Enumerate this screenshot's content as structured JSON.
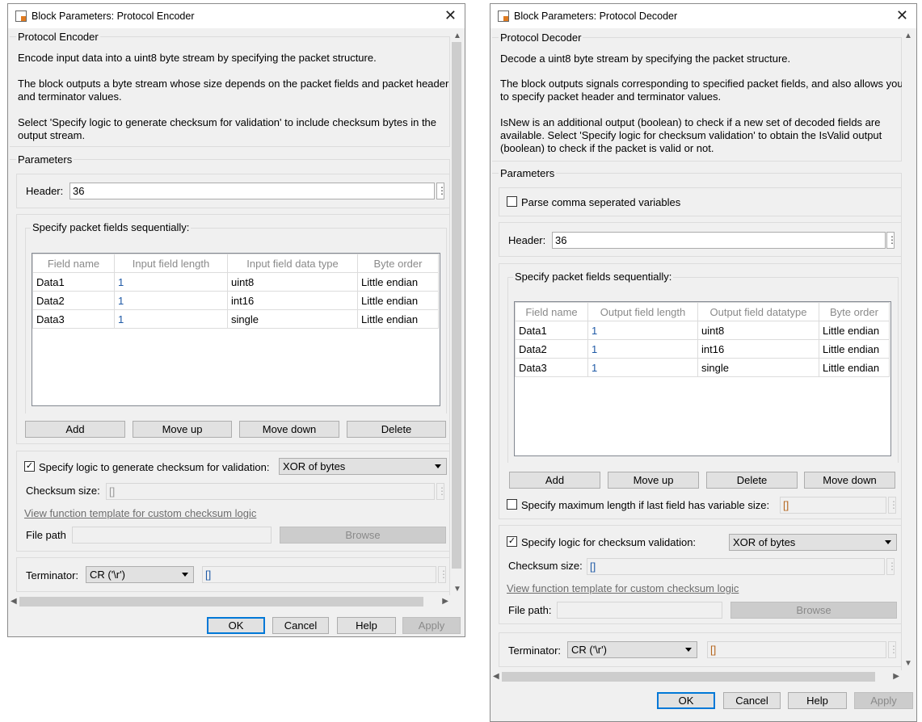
{
  "encoder": {
    "window_title": "Block Parameters: Protocol Encoder",
    "group_title": "Protocol Encoder",
    "description": [
      "Encode input data into a uint8 byte stream by specifying the packet structure.",
      "The block outputs a byte stream whose size depends on the packet fields and packet header",
      "and terminator values.",
      "Select 'Specify logic to generate checksum for validation' to include checksum bytes in the",
      "output stream."
    ],
    "parameters_label": "Parameters",
    "header_label": "Header:",
    "header_value": "36",
    "fields_group": "Specify packet fields sequentially:",
    "table": {
      "columns": [
        "Field name",
        "Input field length",
        "Input field data type",
        "Byte order"
      ],
      "rows": [
        [
          "Data1",
          "1",
          "uint8",
          "Little endian"
        ],
        [
          "Data2",
          "1",
          "int16",
          "Little endian"
        ],
        [
          "Data3",
          "1",
          "single",
          "Little endian"
        ]
      ]
    },
    "table_buttons": [
      "Add",
      "Move up",
      "Move down",
      "Delete"
    ],
    "checksum_checkbox_label": "Specify logic to generate checksum for validation:",
    "checksum_checked": true,
    "checksum_method": "XOR of bytes",
    "checksum_size_label": "Checksum size:",
    "checksum_size_value": "[]",
    "template_link": "View function template for custom checksum logic",
    "file_path_label": "File path",
    "file_path_value": "",
    "browse_label": "Browse",
    "terminator_label": "Terminator:",
    "terminator_value": "CR ('\\r')",
    "terminator_custom_value": "[]",
    "footer_buttons": {
      "ok": "OK",
      "cancel": "Cancel",
      "help": "Help",
      "apply": "Apply"
    }
  },
  "decoder": {
    "window_title": "Block Parameters: Protocol Decoder",
    "group_title": "Protocol Decoder",
    "description": [
      "Decode a uint8 byte stream by specifying the packet structure.",
      "The block outputs signals corresponding to specified packet fields, and also allows you",
      "to specify packet header and terminator values.",
      "IsNew is an additional output (boolean) to check if a new set of decoded fields are",
      "available. Select 'Specify logic for checksum validation' to obtain the IsValid output",
      "(boolean) to check if the packet is valid or not."
    ],
    "parameters_label": "Parameters",
    "parse_csv_label": "Parse comma seperated variables",
    "parse_csv_checked": false,
    "header_label": "Header:",
    "header_value": "36",
    "fields_group": "Specify packet fields sequentially:",
    "table": {
      "columns": [
        "Field name",
        "Output field length",
        "Output field datatype",
        "Byte order"
      ],
      "rows": [
        [
          "Data1",
          "1",
          "uint8",
          "Little endian"
        ],
        [
          "Data2",
          "1",
          "int16",
          "Little endian"
        ],
        [
          "Data3",
          "1",
          "single",
          "Little endian"
        ]
      ]
    },
    "table_buttons": [
      "Add",
      "Move up",
      "Delete",
      "Move down"
    ],
    "max_length_label": "Specify maximum length if last field has variable size:",
    "max_length_checked": false,
    "max_length_value": "[]",
    "checksum_checkbox_label": "Specify logic for checksum validation:",
    "checksum_checked": true,
    "checksum_method": "XOR of bytes",
    "checksum_size_label": "Checksum size:",
    "checksum_size_value": "[]",
    "template_link": "View function template for custom checksum logic",
    "file_path_label": "File path:",
    "file_path_value": "",
    "browse_label": "Browse",
    "terminator_label": "Terminator:",
    "terminator_value": "CR ('\\r')",
    "terminator_custom_value": "[]",
    "footer_buttons": {
      "ok": "OK",
      "cancel": "Cancel",
      "help": "Help",
      "apply": "Apply"
    }
  }
}
